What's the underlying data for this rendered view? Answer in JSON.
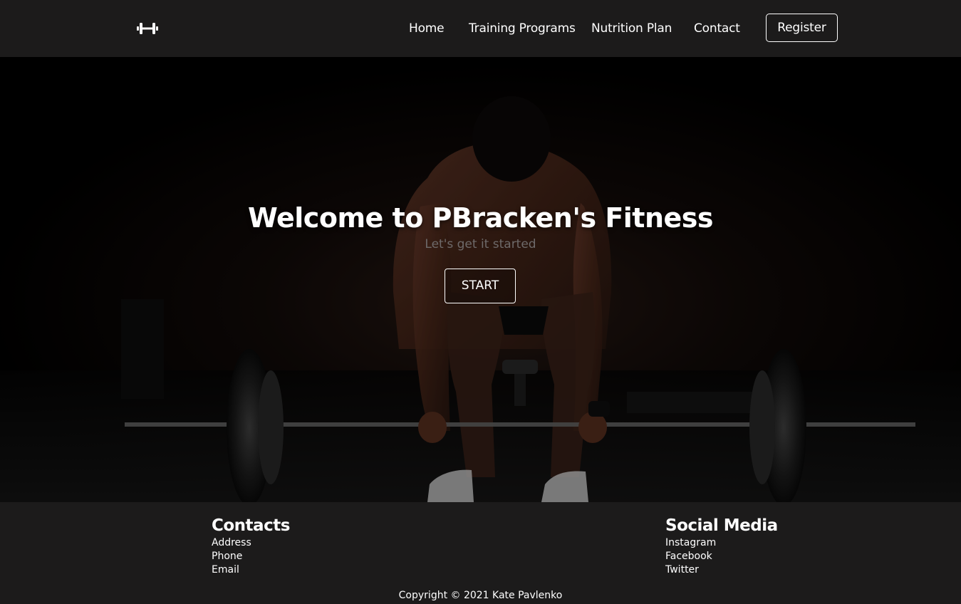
{
  "navbar": {
    "logo_icon": "dumbbell-icon",
    "links": [
      {
        "label": "Home"
      },
      {
        "label": "Training Programs"
      },
      {
        "label": "Nutrition Plan"
      },
      {
        "label": "Contact"
      }
    ],
    "register_label": "Register"
  },
  "hero": {
    "title": "Welcome to PBracken's Fitness",
    "subtitle": "Let's get it started",
    "start_label": "START"
  },
  "footer": {
    "contacts": {
      "heading": "Contacts",
      "items": [
        "Address",
        "Phone",
        "Email"
      ]
    },
    "social": {
      "heading": "Social Media",
      "items": [
        "Instagram",
        "Facebook",
        "Twitter"
      ]
    },
    "copyright": "Copyright © 2021 Kate Pavlenko"
  },
  "colors": {
    "bar_background": "#1c1b1b",
    "hero_background": "#000000",
    "text": "#ffffff",
    "subtitle": "#6e6a6a"
  }
}
